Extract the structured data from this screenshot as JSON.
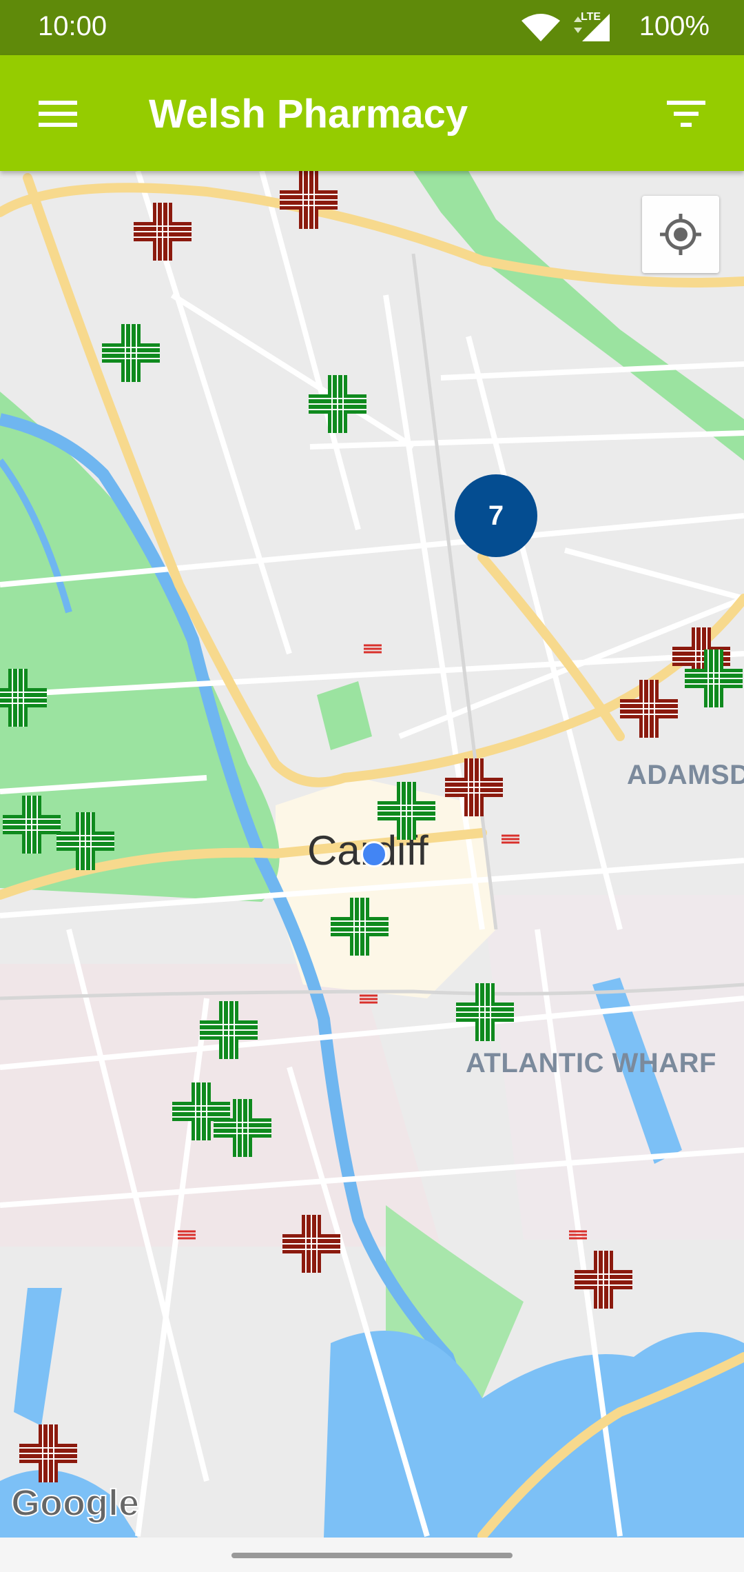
{
  "status_bar": {
    "time": "10:00",
    "network": "LTE",
    "battery": "100%"
  },
  "app_bar": {
    "title": "Welsh Pharmacy",
    "menu_icon": "hamburger-menu-icon",
    "filter_icon": "filter-icon"
  },
  "map": {
    "city_label": "Cardiff",
    "area_labels": [
      "ADAMSDO",
      "ATLANTIC WHARF"
    ],
    "cluster_count": "7",
    "attribution": "Google",
    "locate_icon": "my-location-icon",
    "marker_colors": {
      "open": "#0f8a1e",
      "closed": "#8b1a0e"
    }
  }
}
